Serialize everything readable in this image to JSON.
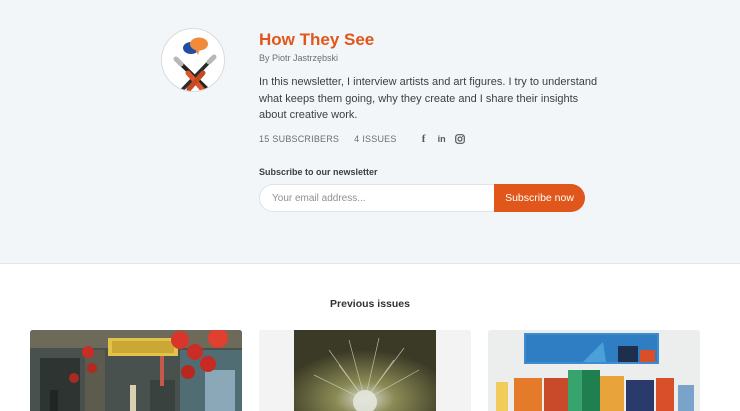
{
  "newsletter": {
    "title": "How They See",
    "byline": "By Piotr Jastrzębski",
    "description": "In this newsletter, I interview artists and art figures. I try to understand what keeps them going, why they create and I share their insights about creative work.",
    "subscribers_count": "15",
    "subscribers_label": "SUBSCRIBERS",
    "issues_count": "4",
    "issues_label": "ISSUES",
    "social_icons": [
      "facebook-icon",
      "linkedin-icon",
      "instagram-icon"
    ],
    "social_glyphs": {
      "facebook": "f",
      "linkedin": "in"
    }
  },
  "subscribe": {
    "label": "Subscribe to our newsletter",
    "email_placeholder": "Your email address...",
    "button_label": "Subscribe now"
  },
  "previous_issues": {
    "heading": "Previous issues",
    "cards": [
      {
        "image": "street-market-painting"
      },
      {
        "image": "abstract-radial-painting"
      },
      {
        "image": "geometric-gallery-paintings"
      }
    ]
  },
  "colors": {
    "accent": "#e0561b",
    "hero_background": "#f3f6f8"
  }
}
